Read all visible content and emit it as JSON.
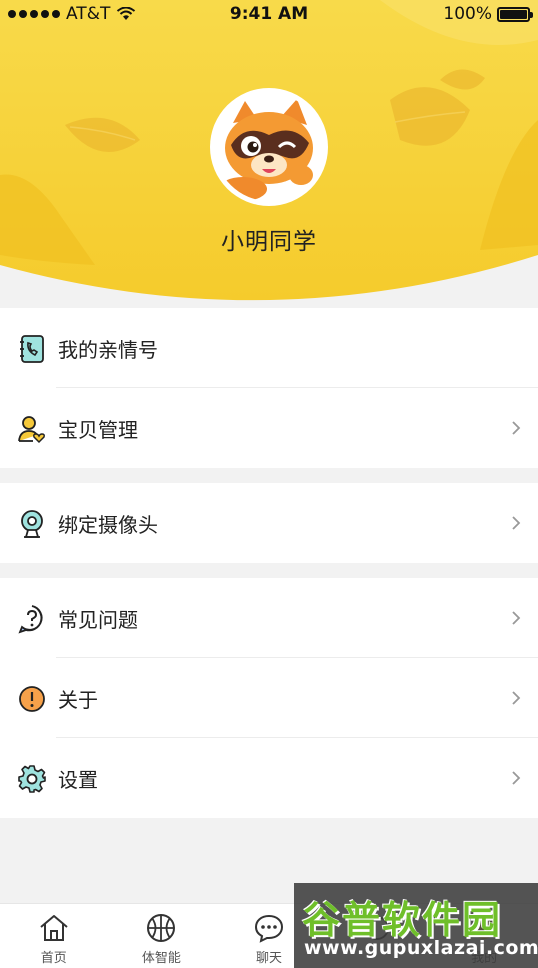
{
  "status_bar": {
    "carrier": "AT&T",
    "time": "9:41 AM",
    "battery": "100%"
  },
  "profile": {
    "name": "小明同学"
  },
  "menu": {
    "family_number": "我的亲情号",
    "baby_management": "宝贝管理",
    "bind_camera": "绑定摄像头",
    "faq": "常见问题",
    "about": "关于",
    "settings": "设置"
  },
  "tabs": [
    {
      "label": "首页",
      "icon": "home-icon"
    },
    {
      "label": "体智能",
      "icon": "basketball-icon"
    },
    {
      "label": "聊天",
      "icon": "chat-icon"
    },
    {
      "label": "",
      "icon": "partial-icon"
    },
    {
      "label": "我的",
      "icon": "me-icon"
    }
  ],
  "watermark": {
    "title": "谷普软件园",
    "url": "www.gupuxlazai.com"
  },
  "colors": {
    "header_yellow": "#f6d23c",
    "accent_teal": "#3ab6b0",
    "accent_yellow": "#f3c433"
  }
}
